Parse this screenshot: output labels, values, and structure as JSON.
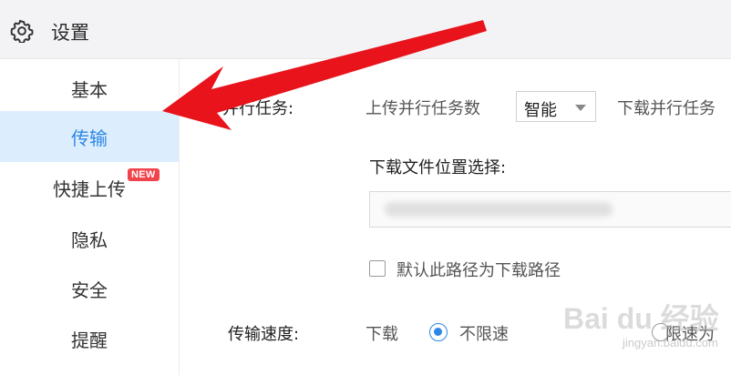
{
  "window": {
    "title": "设置",
    "icon": "gear-icon"
  },
  "sidebar": {
    "items": [
      {
        "label": "基本",
        "active": false
      },
      {
        "label": "传输",
        "active": true
      },
      {
        "label": "快捷上传",
        "active": false,
        "badge": "NEW"
      },
      {
        "label": "隐私",
        "active": false
      },
      {
        "label": "安全",
        "active": false
      },
      {
        "label": "提醒",
        "active": false
      }
    ]
  },
  "parallel": {
    "label": "并行任务:",
    "upload_label": "上传并行任务数",
    "upload_value": "智能",
    "download_label": "下载并行任务"
  },
  "download_location": {
    "label": "下载文件位置选择:",
    "default_checkbox_label": "默认此路径为下载路径",
    "default_checked": false
  },
  "speed": {
    "label": "传输速度:",
    "download_label": "下载",
    "option_unlimited": "不限速",
    "option_limited": "限速为",
    "selected": "不限速"
  },
  "watermark": {
    "brand": "Bai du 经验",
    "url": "jingyan.baidu.com"
  },
  "colors": {
    "accent": "#2d86e6",
    "active_bg": "#dcedfd",
    "badge": "#f0434b",
    "arrow": "#e8131b"
  }
}
